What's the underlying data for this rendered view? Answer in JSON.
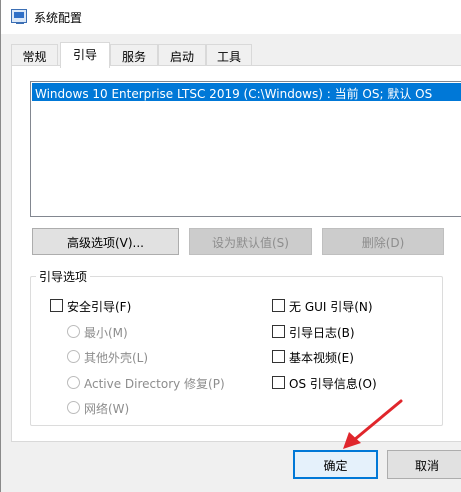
{
  "window": {
    "title": "系统配置"
  },
  "tabs": [
    {
      "label": "常规"
    },
    {
      "label": "引导"
    },
    {
      "label": "服务"
    },
    {
      "label": "启动"
    },
    {
      "label": "工具"
    }
  ],
  "boot": {
    "os_entries": [
      {
        "label": "Windows 10 Enterprise LTSC 2019 (C:\\Windows) : 当前 OS; 默认 OS",
        "selected": true
      }
    ],
    "buttons": {
      "advanced": "高级选项(V)...",
      "set_default": "设为默认值(S)",
      "delete": "删除(D)"
    },
    "options": {
      "legend": "引导选项",
      "safe_boot": {
        "label": "安全引导(F)",
        "checked": false
      },
      "safe_modes": [
        {
          "label": "最小(M)"
        },
        {
          "label": "其他外壳(L)"
        },
        {
          "label": "Active Directory 修复(P)"
        },
        {
          "label": "网络(W)"
        }
      ],
      "flags": [
        {
          "label": "无 GUI 引导(N)",
          "checked": false
        },
        {
          "label": "引导日志(B)",
          "checked": false
        },
        {
          "label": "基本视频(E)",
          "checked": false
        },
        {
          "label": "OS 引导信息(O)",
          "checked": false
        }
      ]
    }
  },
  "footer": {
    "ok": "确定",
    "cancel": "取消"
  },
  "colors": {
    "selection": "#0078d7",
    "arrow": "#e0262c"
  }
}
